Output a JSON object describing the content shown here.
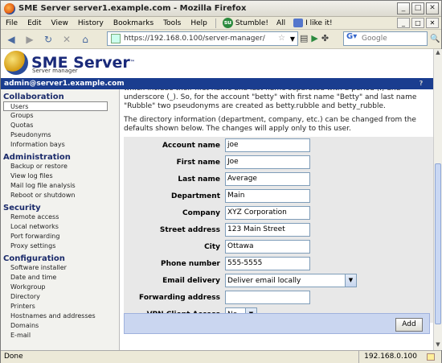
{
  "window": {
    "title": "SME Server server1.example.com - Mozilla Firefox"
  },
  "menubar": {
    "items": [
      "File",
      "Edit",
      "View",
      "History",
      "Bookmarks",
      "Tools",
      "Help"
    ],
    "stumble_label": "Stumble!",
    "all_label": "All",
    "like_label": "I like it!"
  },
  "navbar": {
    "url": "https://192.168.0.100/server-manager/",
    "search_placeholder": "Google"
  },
  "header": {
    "brand": "SME Server",
    "tm": "™",
    "subtitle": "Server manager"
  },
  "userbar": {
    "user": "admin@server1.example.com",
    "help": "?"
  },
  "sidebar": {
    "sections": [
      {
        "title": "Collaboration",
        "items": [
          "Users",
          "Groups",
          "Quotas",
          "Pseudonyms",
          "Information bays"
        ]
      },
      {
        "title": "Administration",
        "items": [
          "Backup or restore",
          "View log files",
          "Mail log file analysis",
          "Reboot or shutdown"
        ]
      },
      {
        "title": "Security",
        "items": [
          "Remote access",
          "Local networks",
          "Port forwarding",
          "Proxy settings"
        ]
      },
      {
        "title": "Configuration",
        "items": [
          "Software installer",
          "Date and time",
          "Workgroup",
          "Directory",
          "Printers",
          "Hostnames and addresses",
          "Domains",
          "E-mail"
        ]
      }
    ]
  },
  "main": {
    "para_cut": "which include their first name and last name separated with a period (.) and underscore (_). So, for the account \"betty\" with first name \"Betty\" and last name \"Rubble\" two pseudonyms are created as betty.rubble and betty_rubble.",
    "para2": "The directory information (department, company, etc.) can be changed from the defaults shown below. The changes will apply only to this user.",
    "fields": [
      {
        "label": "Account name",
        "value": "joe"
      },
      {
        "label": "First name",
        "value": "Joe"
      },
      {
        "label": "Last name",
        "value": "Average"
      },
      {
        "label": "Department",
        "value": "Main"
      },
      {
        "label": "Company",
        "value": "XYZ Corporation"
      },
      {
        "label": "Street address",
        "value": "123 Main Street"
      },
      {
        "label": "City",
        "value": "Ottawa"
      },
      {
        "label": "Phone number",
        "value": "555-5555"
      }
    ],
    "email_delivery": {
      "label": "Email delivery",
      "value": "Deliver email locally"
    },
    "forwarding": {
      "label": "Forwarding address",
      "value": ""
    },
    "vpn": {
      "label": "VPN Client Access",
      "value": "No"
    },
    "add_button": "Add"
  },
  "status": {
    "text": "Done",
    "ip": "192.168.0.100"
  }
}
